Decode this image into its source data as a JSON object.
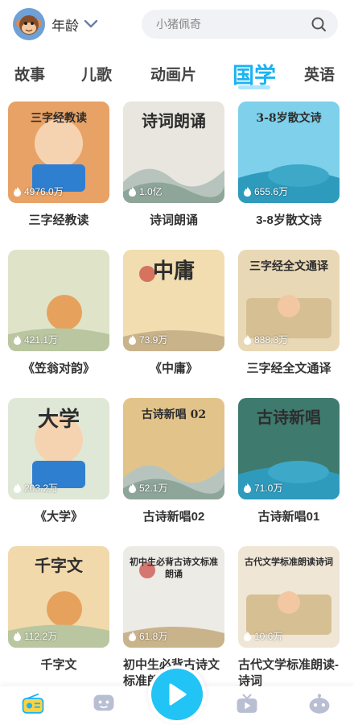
{
  "header": {
    "age_label": "年龄",
    "search_placeholder": "小猪佩奇"
  },
  "tabs": [
    {
      "label": "故事",
      "active": false
    },
    {
      "label": "儿歌",
      "active": false
    },
    {
      "label": "动画片",
      "active": false
    },
    {
      "label": "国学",
      "active": true
    },
    {
      "label": "英语",
      "active": false
    }
  ],
  "cards": [
    {
      "title": "三字经教读",
      "plays": "4976.0万",
      "art": "三字经教读",
      "color": "#e8a266"
    },
    {
      "title": "诗词朗诵",
      "plays": "1.0亿",
      "art": "诗词朗诵",
      "color": "#e9e6e0"
    },
    {
      "title": "3-8岁散文诗",
      "plays": "655.6万",
      "art": "3-8岁散文诗",
      "color": "#7fd0ea"
    },
    {
      "title": "《笠翁对韵》",
      "plays": "421.1万",
      "art": "",
      "color": "#dfe4c9"
    },
    {
      "title": "《中庸》",
      "plays": "73.9万",
      "art": "中庸",
      "color": "#f1ddb0"
    },
    {
      "title": "三字经全文通译",
      "plays": "838.3万",
      "art": "三字经全文通译",
      "color": "#e9d8b5"
    },
    {
      "title": "《大学》",
      "plays": "203.2万",
      "art": "大学",
      "color": "#dfe8d6"
    },
    {
      "title": "古诗新唱02",
      "plays": "52.1万",
      "art": "古诗新唱 02",
      "color": "#e2c48a"
    },
    {
      "title": "古诗新唱01",
      "plays": "71.0万",
      "art": "古诗新唱",
      "color": "#3f7a6e"
    },
    {
      "title": "千字文",
      "plays": "112.2万",
      "art": "千字文",
      "color": "#f1d9ab"
    },
    {
      "title": "初中生必背古诗文标准朗诵",
      "plays": "61.8万",
      "art": "初中生必背古诗文标准朗诵",
      "color": "#ecebe6"
    },
    {
      "title": "古代文学标准朗读-诗词",
      "plays": "10.6万",
      "art": "古代文学标准朗读诗词",
      "color": "#efe6d6"
    }
  ],
  "bottom_nav": [
    {
      "icon": "radio-icon",
      "active": true
    },
    {
      "icon": "chat-icon",
      "active": false
    },
    {
      "icon": "play-icon",
      "active": false
    },
    {
      "icon": "tv-icon",
      "active": false
    },
    {
      "icon": "robot-icon",
      "active": false
    }
  ],
  "colors": {
    "accent": "#1ab3f5",
    "fab": "#22c3f5"
  }
}
